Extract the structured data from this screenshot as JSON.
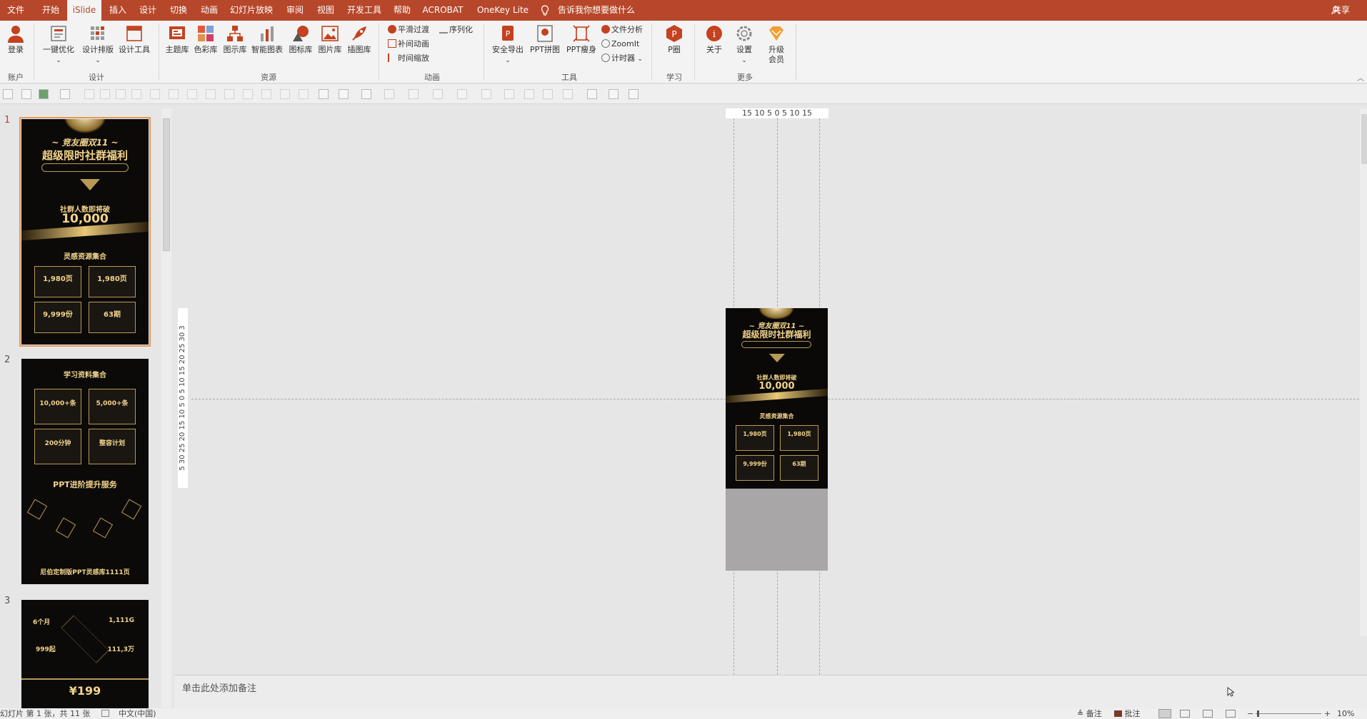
{
  "menu": {
    "items": [
      "文件",
      "开始",
      "iSlide",
      "插入",
      "设计",
      "切换",
      "动画",
      "幻灯片放映",
      "审阅",
      "视图",
      "开发工具",
      "帮助",
      "ACROBAT",
      "OneKey Lite"
    ],
    "active_index": 2,
    "tell_me": "告诉我你想要做什么",
    "share": "共享"
  },
  "ribbon": {
    "account": {
      "login": "登录",
      "group": "账户"
    },
    "design": {
      "optimize": "一键优化",
      "layout": "设计排版",
      "tools": "设计工具",
      "group": "设计"
    },
    "resources": {
      "theme": "主题库",
      "color": "色彩库",
      "diagram": "图示库",
      "chart": "智能图表",
      "icon": "图标库",
      "picture": "图片库",
      "illustration": "插图库",
      "group": "资源"
    },
    "animation": {
      "smooth": "平滑过渡",
      "tween": "补间动画",
      "time_scale": "时间缩放",
      "sequence": "序列化",
      "group": "动画"
    },
    "tools": {
      "safe_export": "安全导出",
      "ppt_collage": "PPT拼图",
      "ppt_slim": "PPT瘦身",
      "file_analysis": "文件分析",
      "zoomit": "ZoomIt",
      "timer": "计时器",
      "group": "工具"
    },
    "learn": {
      "p_circle": "P圈",
      "group": "学习"
    },
    "more": {
      "about": "关于",
      "settings": "设置",
      "upgrade": "升级会员",
      "group": "更多"
    }
  },
  "slides": {
    "numbers": [
      "1",
      "2",
      "3"
    ],
    "s1": {
      "line1": "~ 竞友圈双11 ~",
      "line2": "超级限时社群福利",
      "line3": "社群人数即将破",
      "line4": "10,000",
      "line5": "灵感资源集合",
      "q1": "1,980页",
      "q2": "1,980页",
      "q3": "9,999份",
      "q4": "63期"
    },
    "s2": {
      "line1": "学习资料集合",
      "q1": "10,000+条",
      "q2": "5,000+条",
      "q3": "200分钟",
      "q4": "整容计划",
      "line2": "PPT进阶提升服务",
      "footer": "尼伯定制版PPT灵感库1111页"
    },
    "s3": {
      "q1": "6个月",
      "q2": "1,111G",
      "q3": "999起",
      "q4": "111,3万",
      "price": "¥199"
    }
  },
  "ruler": {
    "horizontal": "15 10 5  0  5 10 15",
    "vertical": "5 30 25 20 15 10  5  0  5 10 15 20 25 30 3"
  },
  "notes": {
    "placeholder": "单击此处添加备注"
  },
  "status": {
    "slide_info": "幻灯片 第 1 张，共 11 张",
    "language": "中文(中国)",
    "notes": "备注",
    "comments": "批注",
    "zoom": "10%"
  },
  "colors": {
    "accent": "#b7472a",
    "gold": "#e0c27a"
  }
}
